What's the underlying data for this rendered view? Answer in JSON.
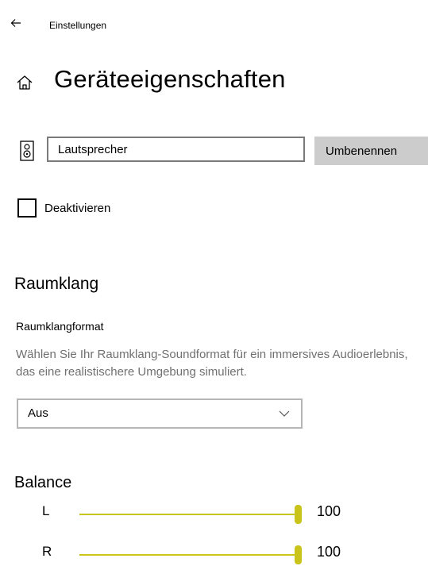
{
  "header": {
    "window_title": "Einstellungen",
    "back_icon": "back-arrow-icon",
    "home_icon": "home-icon",
    "page_title": "Geräteeigenschaften"
  },
  "device": {
    "icon": "speaker-icon",
    "name_value": "Lautsprecher",
    "rename_label": "Umbenennen"
  },
  "disable": {
    "label": "Deaktivieren",
    "checked": false
  },
  "spatial_sound": {
    "section_title": "Raumklang",
    "format_title": "Raumklangformat",
    "description": "Wählen Sie Ihr Raumklang-Soundformat für ein immersives Audioerlebnis, das eine realistischere Umgebung simuliert.",
    "selected": "Aus"
  },
  "balance": {
    "title": "Balance",
    "channels": [
      {
        "label": "L",
        "value": "100",
        "level": 1.0
      },
      {
        "label": "R",
        "value": "100",
        "level": 1.0
      }
    ]
  },
  "colors": {
    "accent": "#c9c31a",
    "button_bg": "#cccccc",
    "description_text": "#707070"
  }
}
